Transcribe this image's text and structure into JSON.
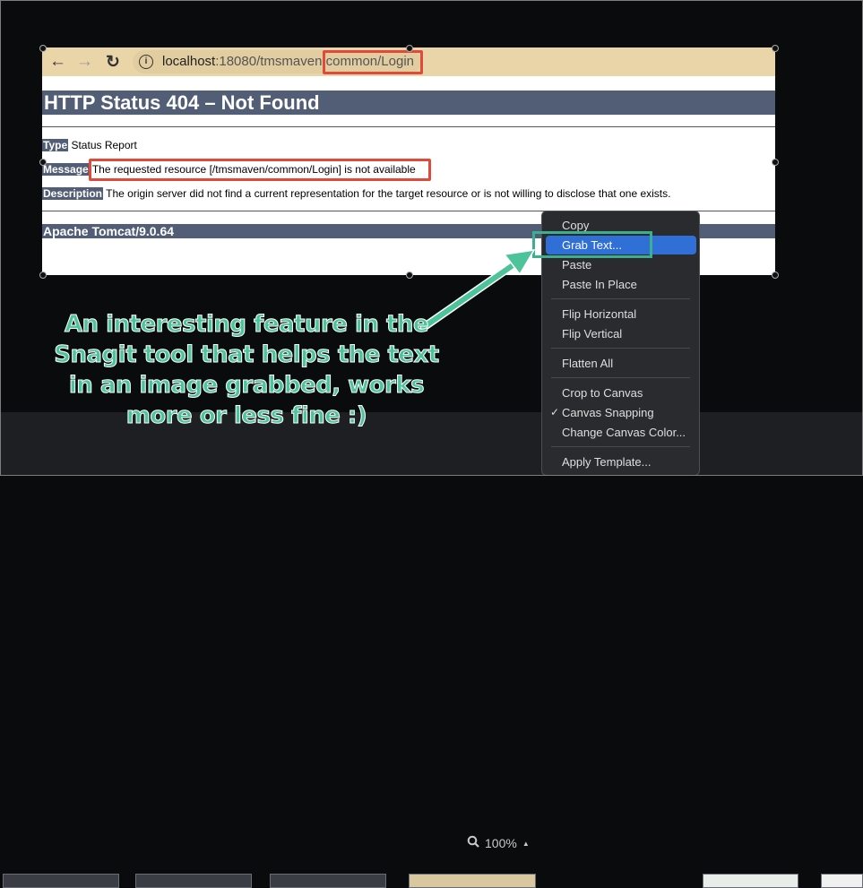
{
  "browser": {
    "back_icon": "←",
    "forward_icon": "→",
    "reload_icon": "↻",
    "info_icon": "i",
    "url_host": "localhost",
    "url_rest": ":18080/tmsmaven",
    "url_path": "common/Login"
  },
  "page": {
    "title": "HTTP Status 404 – Not Found",
    "type_label": "Type",
    "type_value": "Status Report",
    "message_label": "Message",
    "message_value": "The requested resource [/tmsmaven/common/Login] is not available",
    "description_label": "Description",
    "description_value": "The origin server did not find a current representation for the target resource or is not willing to disclose that one exists.",
    "footer": "Apache Tomcat/9.0.64"
  },
  "context_menu": {
    "items": [
      {
        "label": "Copy"
      },
      {
        "label": "Grab Text...",
        "selected": true
      },
      {
        "label": "Paste"
      },
      {
        "label": "Paste In Place"
      },
      {
        "label": "Flip Horizontal"
      },
      {
        "label": "Flip Vertical"
      },
      {
        "label": "Flatten All"
      },
      {
        "label": "Crop to Canvas"
      },
      {
        "label": "Canvas Snapping",
        "checked": true
      },
      {
        "label": "Change Canvas Color..."
      },
      {
        "label": "Apply Template..."
      }
    ],
    "check_mark": "✓"
  },
  "annotation": {
    "text": "An interesting feature in the Snagit tool that helps the text in an image grabbed, works more or less fine :)"
  },
  "toolbar": {
    "zoom": "100%",
    "zoom_caret": "▲"
  },
  "colors": {
    "accent_highlight": "#e04a3b",
    "annotation": "#4dc39a",
    "menu_selection": "#2f6fd6",
    "tomcat_header": "#525d76"
  }
}
